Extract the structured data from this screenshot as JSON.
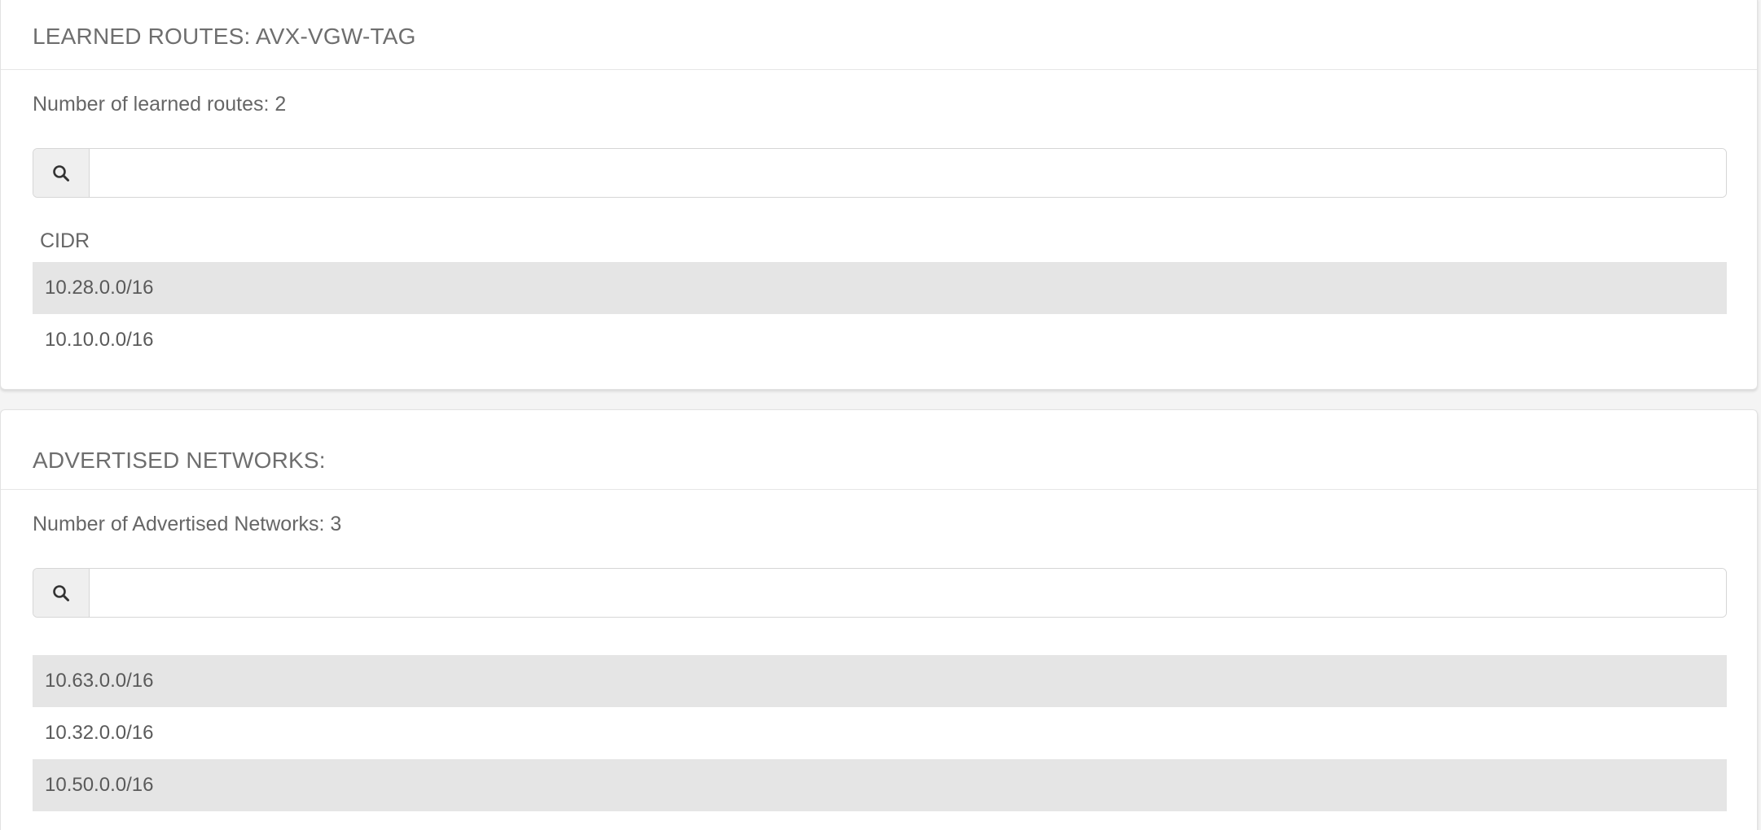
{
  "learned_routes": {
    "title": "LEARNED ROUTES: AVX-VGW-TAG",
    "count_text": "Number of learned routes: 2",
    "search": {
      "placeholder": "",
      "value": ""
    },
    "column_header": "CIDR",
    "rows": [
      "10.28.0.0/16",
      "10.10.0.0/16"
    ]
  },
  "advertised_networks": {
    "title": "ADVERTISED NETWORKS:",
    "count_text": "Number of Advertised Networks: 3",
    "search": {
      "placeholder": "",
      "value": ""
    },
    "rows": [
      "10.63.0.0/16",
      "10.32.0.0/16",
      "10.50.0.0/16"
    ]
  },
  "icons": {
    "search": "search-icon"
  },
  "colors": {
    "stripe": "#e5e5e5",
    "border": "#d6d6d6",
    "text": "#555555"
  }
}
